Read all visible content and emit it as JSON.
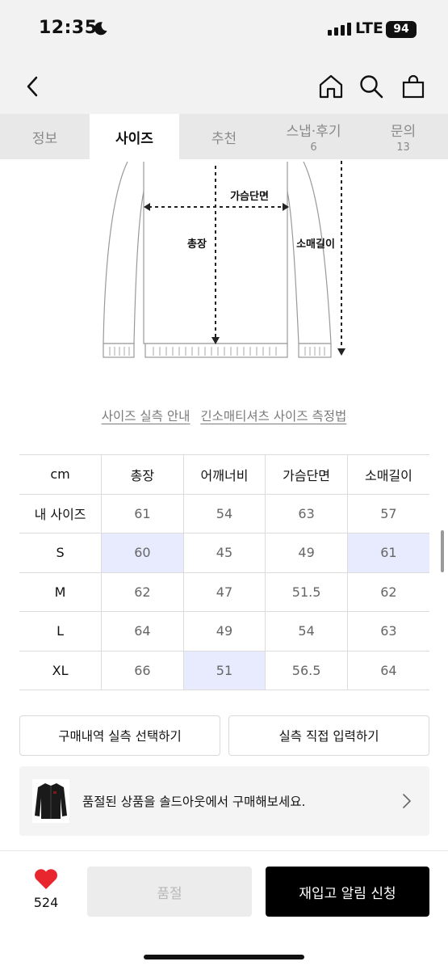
{
  "status_bar": {
    "time": "12:35",
    "network": "LTE",
    "battery": "94"
  },
  "tabs": [
    {
      "label": "정보",
      "count": ""
    },
    {
      "label": "사이즈",
      "count": ""
    },
    {
      "label": "추천",
      "count": ""
    },
    {
      "label": "스냅·후기",
      "count": "6"
    },
    {
      "label": "문의",
      "count": "13"
    }
  ],
  "diagram": {
    "chest": "가슴단면",
    "length": "총장",
    "sleeve": "소매길이"
  },
  "guide_links": {
    "size_guide": "사이즈 실측 안내",
    "measure_guide": "긴소매티셔츠 사이즈 측정법"
  },
  "size_table": {
    "headers": [
      "cm",
      "총장",
      "어깨너비",
      "가슴단면",
      "소매길이"
    ],
    "rows": [
      [
        "내 사이즈",
        "61",
        "54",
        "63",
        "57"
      ],
      [
        "S",
        "60",
        "45",
        "49",
        "61"
      ],
      [
        "M",
        "62",
        "47",
        "51.5",
        "62"
      ],
      [
        "L",
        "64",
        "49",
        "54",
        "63"
      ],
      [
        "XL",
        "66",
        "51",
        "56.5",
        "64"
      ]
    ]
  },
  "buttons": {
    "select_purchase": "구매내역 실측 선택하기",
    "direct_input": "실측 직접 입력하기"
  },
  "soldout_banner": {
    "text": "품절된 상품을 솔드아웃에서 구매해보세요."
  },
  "bottom_bar": {
    "like_count": "524",
    "soldout_label": "품절",
    "restock_label": "재입고 알림 신청"
  },
  "colors": {
    "highlight": "#e8ebfd",
    "like": "#e8262e",
    "primary": "#000000"
  }
}
